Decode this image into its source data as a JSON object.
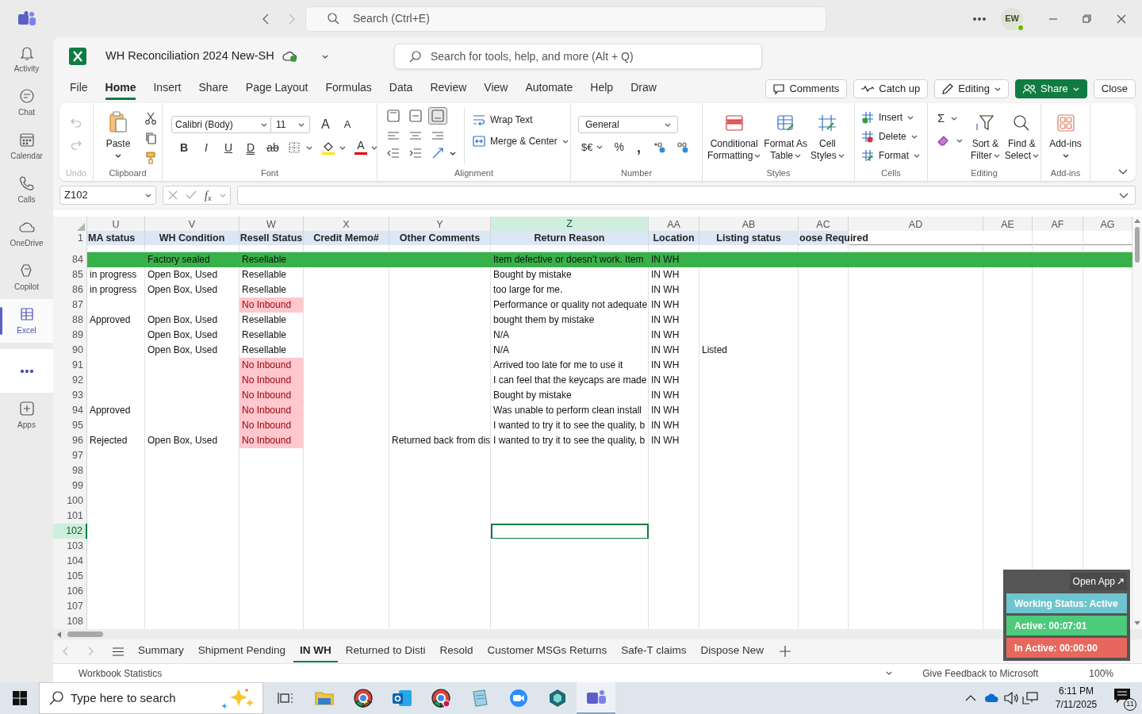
{
  "teams": {
    "search_placeholder": "Search (Ctrl+E)",
    "avatar": "EW",
    "rail": [
      {
        "label": "Activity",
        "selected": false
      },
      {
        "label": "Chat",
        "selected": false
      },
      {
        "label": "Calendar",
        "selected": false
      },
      {
        "label": "Calls",
        "selected": false
      },
      {
        "label": "OneDrive",
        "selected": false
      },
      {
        "label": "Copilot",
        "selected": false
      },
      {
        "label": "Excel",
        "selected": true
      }
    ],
    "apps_button": {
      "label": "Apps"
    }
  },
  "workbook": {
    "title": "WH Reconciliation 2024 New-SH",
    "search_placeholder": "Search for tools, help, and more (Alt + Q)"
  },
  "menu_tabs": [
    {
      "label": "File",
      "selected": false
    },
    {
      "label": "Home",
      "selected": true
    },
    {
      "label": "Insert",
      "selected": false
    },
    {
      "label": "Share",
      "selected": false
    },
    {
      "label": "Page Layout",
      "selected": false
    },
    {
      "label": "Formulas",
      "selected": false
    },
    {
      "label": "Data",
      "selected": false
    },
    {
      "label": "Review",
      "selected": false
    },
    {
      "label": "View",
      "selected": false
    },
    {
      "label": "Automate",
      "selected": false
    },
    {
      "label": "Help",
      "selected": false
    },
    {
      "label": "Draw",
      "selected": false
    }
  ],
  "actions": [
    {
      "label": "Comments",
      "kind": "comment"
    },
    {
      "label": "Catch up",
      "kind": "catchup"
    },
    {
      "label": "Editing",
      "kind": "editing"
    },
    {
      "label": "Share",
      "kind": "share"
    },
    {
      "label": "Close",
      "kind": "plain"
    }
  ],
  "ribbon": {
    "undo": {
      "group": "Undo"
    },
    "clipboard": {
      "group": "Clipboard",
      "paste": "Paste"
    },
    "font": {
      "group": "Font",
      "family": "Calibri (Body)",
      "size": "11",
      "size_buttons": [
        "A",
        "A"
      ],
      "format_buttons": [
        "B",
        "I",
        "U",
        "D",
        "ab"
      ],
      "color_button": "A"
    },
    "alignment": {
      "group": "Alignment",
      "vertical": [
        {
          "selected": false
        },
        {
          "selected": false
        },
        {
          "selected": true
        }
      ],
      "wrap": "Wrap Text",
      "merge": "Merge & Center"
    },
    "number": {
      "group": "Number",
      "format": "General",
      "currency": "$€",
      "percent": "%",
      "comma": ","
    },
    "styles": {
      "group": "Styles",
      "buttons": [
        {
          "line1": "Conditional",
          "line2": "Formatting"
        },
        {
          "line1": "Format As",
          "line2": "Table"
        },
        {
          "line1": "Cell",
          "line2": "Styles"
        }
      ]
    },
    "cells": {
      "group": "Cells",
      "buttons": [
        "Insert",
        "Delete",
        "Format"
      ]
    },
    "editing": {
      "group": "Editing",
      "sum": "Σ",
      "buttons": [
        {
          "line1": "Sort &",
          "line2": "Filter"
        },
        {
          "line1": "Find &",
          "line2": "Select"
        }
      ]
    },
    "addins": {
      "group": "Add-ins",
      "button": "Add-ins"
    }
  },
  "formula_bar": {
    "name_box": "Z102",
    "function_label": "f$_{x}$"
  },
  "sheet": {
    "header_row": "1",
    "columns": [
      {
        "letter": "U",
        "header": "MA status",
        "selected": false
      },
      {
        "letter": "V",
        "header": "WH Condition",
        "selected": false
      },
      {
        "letter": "W",
        "header": "Resell Status",
        "selected": false
      },
      {
        "letter": "X",
        "header": "Credit Memo#",
        "selected": false
      },
      {
        "letter": "Y",
        "header": "Other Comments",
        "selected": false
      },
      {
        "letter": "Z",
        "header": "Return Reason",
        "selected": true
      },
      {
        "letter": "AA",
        "header": "Location",
        "selected": false
      },
      {
        "letter": "AB",
        "header": "Listing status",
        "selected": false
      },
      {
        "letter": "AC",
        "header": "oose Required",
        "selected": false
      },
      {
        "letter": "AD",
        "selected": false
      },
      {
        "letter": "AE",
        "selected": false
      },
      {
        "letter": "AF",
        "selected": false
      },
      {
        "letter": "AG",
        "selected": false
      }
    ],
    "rows": [
      {
        "number": "84",
        "highlighted": true,
        "selected": false,
        "cells": {
          "V": "Factory sealed",
          "W": "Resellable",
          "Z": "Item defective or doesn’t work. Item",
          "AA": "IN WH"
        }
      },
      {
        "number": "85",
        "highlighted": false,
        "selected": false,
        "cells": {
          "U": "in progress",
          "V": "Open Box, Used",
          "W": "Resellable",
          "Z": "Bought by mistake",
          "AA": "IN WH"
        }
      },
      {
        "number": "86",
        "highlighted": false,
        "selected": false,
        "cells": {
          "U": "in progress",
          "V": "Open Box, Used",
          "W": "Resellable",
          "Z": "too large for me.",
          "AA": "IN WH"
        }
      },
      {
        "number": "87",
        "highlighted": false,
        "selected": false,
        "cells": {
          "W": {
            "text": "No Inbound",
            "color": "#ffc7ce"
          },
          "Z": "Performance or quality not adequate",
          "AA": "IN WH"
        }
      },
      {
        "number": "88",
        "highlighted": false,
        "selected": false,
        "cells": {
          "U": "Approved",
          "V": "Open Box, Used",
          "W": "Resellable",
          "Z": "bought them by mistake",
          "AA": "IN WH"
        }
      },
      {
        "number": "89",
        "highlighted": false,
        "selected": false,
        "cells": {
          "V": "Open Box, Used",
          "W": "Resellable",
          "Z": "N/A",
          "AA": "IN WH"
        }
      },
      {
        "number": "90",
        "highlighted": false,
        "selected": false,
        "cells": {
          "V": "Open Box, Used",
          "W": "Resellable",
          "Z": "N/A",
          "AA": "IN WH",
          "AB": "Listed"
        }
      },
      {
        "number": "91",
        "highlighted": false,
        "selected": false,
        "cells": {
          "W": {
            "text": "No Inbound",
            "color": "#ffc7ce"
          },
          "Z": "Arrived too late for me to use it",
          "AA": "IN WH"
        }
      },
      {
        "number": "92",
        "highlighted": false,
        "selected": false,
        "cells": {
          "W": {
            "text": "No Inbound",
            "color": "#ffc7ce"
          },
          "Z": "I can feel that the keycaps are made",
          "AA": "IN WH"
        }
      },
      {
        "number": "93",
        "highlighted": false,
        "selected": false,
        "cells": {
          "W": {
            "text": "No Inbound",
            "color": "#ffc7ce"
          },
          "Z": "Bought by mistake",
          "AA": "IN WH"
        }
      },
      {
        "number": "94",
        "highlighted": false,
        "selected": false,
        "cells": {
          "U": "Approved",
          "W": {
            "text": "No Inbound",
            "color": "#ffc7ce"
          },
          "Z": "Was unable to perform clean install",
          "AA": "IN WH"
        }
      },
      {
        "number": "95",
        "highlighted": false,
        "selected": false,
        "cells": {
          "W": {
            "text": "No Inbound",
            "color": "#ffc7ce"
          },
          "Z": "I wanted to try it to see the quality, b",
          "AA": "IN WH"
        }
      },
      {
        "number": "96",
        "highlighted": false,
        "selected": false,
        "cells": {
          "U": "Rejected",
          "V": "Open Box, Used",
          "W": {
            "text": "No Inbound",
            "color": "#ffc7ce"
          },
          "Y": "Returned back from dis",
          "Z": "I wanted to try it to see the quality, b",
          "AA": "IN WH"
        }
      },
      {
        "number": "97",
        "highlighted": false,
        "selected": false
      },
      {
        "number": "98",
        "highlighted": false,
        "selected": false
      },
      {
        "number": "99",
        "highlighted": false,
        "selected": false
      },
      {
        "number": "100",
        "highlighted": false,
        "selected": false
      },
      {
        "number": "101",
        "highlighted": false,
        "selected": false
      },
      {
        "number": "102",
        "highlighted": false,
        "selected": true
      },
      {
        "number": "103",
        "highlighted": false,
        "selected": false
      },
      {
        "number": "104",
        "highlighted": false,
        "selected": false
      },
      {
        "number": "105",
        "highlighted": false,
        "selected": false
      },
      {
        "number": "106",
        "highlighted": false,
        "selected": false
      },
      {
        "number": "107",
        "highlighted": false,
        "selected": false
      },
      {
        "number": "108",
        "highlighted": false,
        "selected": false
      }
    ]
  },
  "sheet_tabs": [
    {
      "label": "Summary",
      "selected": false
    },
    {
      "label": "Shipment Pending",
      "selected": false
    },
    {
      "label": "IN WH",
      "selected": true
    },
    {
      "label": "Returned to Disti",
      "selected": false
    },
    {
      "label": "Resold",
      "selected": false
    },
    {
      "label": "Customer MSGs Returns",
      "selected": false
    },
    {
      "label": "Safe-T claims",
      "selected": false
    },
    {
      "label": "Dispose New",
      "selected": false
    }
  ],
  "status_bar": {
    "left": "Workbook Statistics",
    "feedback": "Give Feedback to Microsoft",
    "zoom": "100%"
  },
  "tracker": {
    "button": "Open App",
    "items": [
      {
        "label": "Working Status: Active",
        "color": "#6fc5cf"
      },
      {
        "label": "Active: 00:07:01",
        "color": "#4ccb7a"
      },
      {
        "label": "In Active: 00:00:00",
        "color": "#e8675d"
      }
    ]
  },
  "taskbar": {
    "search_placeholder": "Type here to search",
    "time": "6:11 PM",
    "date": "7/11/2025",
    "notifications": "11"
  }
}
